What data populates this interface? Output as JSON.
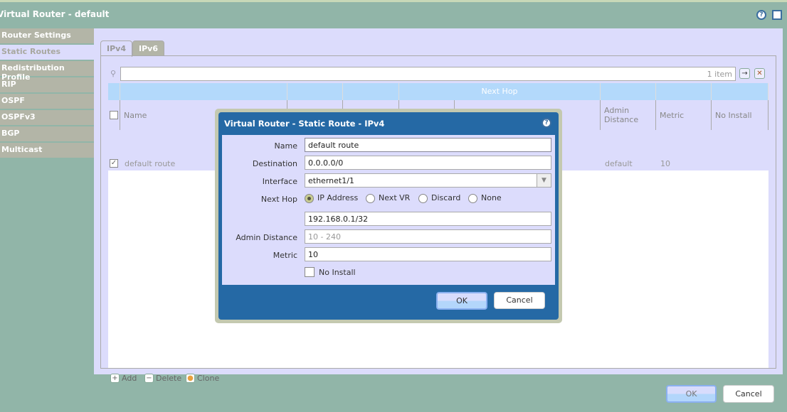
{
  "window": {
    "title": "Virtual Router - default"
  },
  "sidebar": {
    "items": [
      {
        "label": "Router Settings"
      },
      {
        "label": "Static Routes",
        "active": true
      },
      {
        "label": "Redistribution Profile"
      },
      {
        "label": "RIP"
      },
      {
        "label": "OSPF"
      },
      {
        "label": "OSPFv3"
      },
      {
        "label": "BGP"
      },
      {
        "label": "Multicast"
      }
    ]
  },
  "tabs": [
    {
      "label": "IPv4",
      "active": true
    },
    {
      "label": "IPv6"
    }
  ],
  "search": {
    "count": "1 item"
  },
  "table": {
    "group_header": "Next Hop",
    "columns": [
      "Name",
      "Admin Distance",
      "Metric",
      "No Install"
    ],
    "rows": [
      {
        "name": "default route",
        "admin_distance": "default",
        "metric": "10",
        "checked": true
      }
    ]
  },
  "actions": {
    "add": "Add",
    "delete": "Delete",
    "clone": "Clone"
  },
  "footer": {
    "ok": "OK",
    "cancel": "Cancel"
  },
  "dialog": {
    "title": "Virtual Router - Static Route - IPv4",
    "fields": {
      "name_label": "Name",
      "name": "default route",
      "destination_label": "Destination",
      "destination": "0.0.0.0/0",
      "interface_label": "Interface",
      "interface": "ethernet1/1",
      "next_hop_label": "Next Hop",
      "next_hop_options": [
        "IP Address",
        "Next VR",
        "Discard",
        "None"
      ],
      "next_hop_selected": "IP Address",
      "next_hop_ip": "192.168.0.1/32",
      "admin_distance_label": "Admin Distance",
      "admin_distance_placeholder": "10 - 240",
      "metric_label": "Metric",
      "metric": "10",
      "no_install_label": "No Install",
      "no_install": false
    },
    "ok": "OK",
    "cancel": "Cancel"
  },
  "colors": {
    "titlebar": "#91b5a8",
    "panel": "#dcdcfc",
    "dialog": "#2569a5",
    "header": "#b3d9fb"
  }
}
